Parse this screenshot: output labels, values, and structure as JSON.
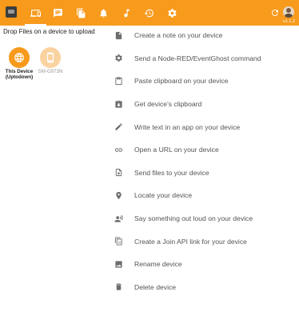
{
  "header": {
    "logo_icon": "join-app-icon",
    "tabs": [
      {
        "icon": "devices-icon",
        "active": true
      },
      {
        "icon": "chat-icon",
        "active": false
      },
      {
        "icon": "files-icon",
        "active": false
      },
      {
        "icon": "notifications-icon",
        "active": false
      },
      {
        "icon": "media-icon",
        "active": false
      },
      {
        "icon": "history-icon",
        "active": false
      },
      {
        "icon": "settings-icon",
        "active": false
      }
    ],
    "refresh_icon": "refresh-icon",
    "version": "v1.1.2",
    "accent_color": "#f89a1c"
  },
  "drop_hint": "Drop Files on a device to upload",
  "devices": [
    {
      "name": "This Device (Uptodown)",
      "icon": "globe-icon",
      "selected": true
    },
    {
      "name": "SM-G973N",
      "icon": "phone-icon",
      "selected": false
    }
  ],
  "actions": [
    {
      "icon": "note-icon",
      "label": "Create a note on your device"
    },
    {
      "icon": "gear-icon",
      "label": "Send a Node-RED/EventGhost command"
    },
    {
      "icon": "clipboard-icon",
      "label": "Paste clipboard on your device"
    },
    {
      "icon": "clipboard-download-icon",
      "label": "Get device's clipboard"
    },
    {
      "icon": "pencil-icon",
      "label": "Write text in an app on your device"
    },
    {
      "icon": "link-icon",
      "label": "Open a URL on your device"
    },
    {
      "icon": "file-upload-icon",
      "label": "Send files to your device"
    },
    {
      "icon": "location-pin-icon",
      "label": "Locate your device"
    },
    {
      "icon": "speak-icon",
      "label": "Say something out loud on your device"
    },
    {
      "icon": "copy-link-icon",
      "label": "Create a Join API link for your device"
    },
    {
      "icon": "image-edit-icon",
      "label": "Rename device"
    },
    {
      "icon": "trash-icon",
      "label": "Delete device"
    }
  ]
}
